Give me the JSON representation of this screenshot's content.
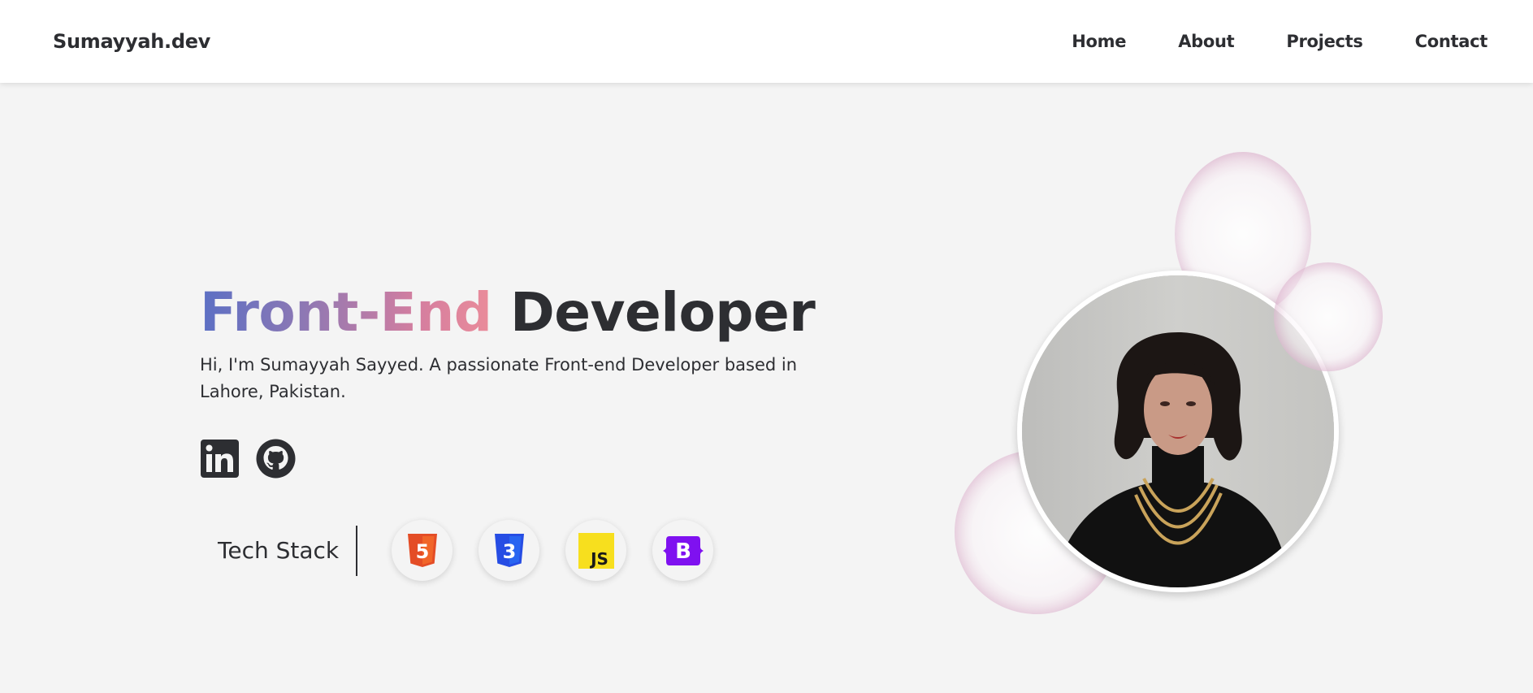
{
  "nav": {
    "logo": "Sumayyah.dev",
    "links": [
      "Home",
      "About",
      "Projects",
      "Contact"
    ]
  },
  "hero": {
    "title_highlight": "Front-End",
    "title_rest": "Developer",
    "description": "Hi, I'm Sumayyah Sayyed. A passionate Front-end Developer based in Lahore, Pakistan.",
    "socials": [
      {
        "icon": "linkedin-icon"
      },
      {
        "icon": "github-icon"
      }
    ]
  },
  "tech_stack": {
    "label": "Tech Stack",
    "items": [
      {
        "icon": "html5-icon",
        "text": "5",
        "color": "#e44d26"
      },
      {
        "icon": "css3-icon",
        "text": "3",
        "color": "#264de4"
      },
      {
        "icon": "javascript-icon",
        "text": "JS",
        "color": "#f7df1e"
      },
      {
        "icon": "bootstrap-icon",
        "text": "B",
        "color": "#7f11f0"
      }
    ]
  },
  "colors": {
    "text": "#2d2e32",
    "background": "#f4f4f4",
    "gradient_start": "#5b6fc4",
    "gradient_end": "#ea8c9a"
  }
}
